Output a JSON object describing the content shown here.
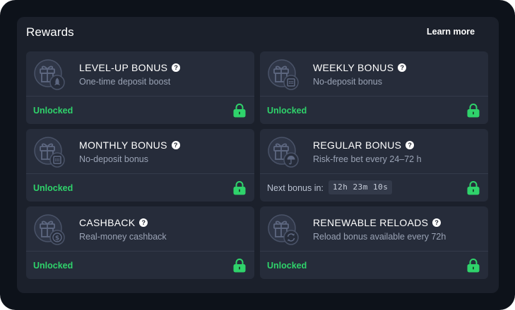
{
  "panel": {
    "title": "Rewards",
    "learn_more": "Learn more"
  },
  "colors": {
    "background": "#0d121a",
    "panel": "#1b202b",
    "card": "#262c3a",
    "unlocked": "#2fd36b",
    "muted_text": "#9aa3b5"
  },
  "cards": [
    {
      "title": "LEVEL-UP BONUS",
      "subtitle": "One-time deposit boost",
      "status": "Unlocked",
      "badge_icon": "rocket-icon"
    },
    {
      "title": "WEEKLY BONUS",
      "subtitle": "No-deposit bonus",
      "status": "Unlocked",
      "badge_icon": "calendar-icon"
    },
    {
      "title": "MONTHLY BONUS",
      "subtitle": "No-deposit bonus",
      "status": "Unlocked",
      "badge_icon": "calendar-icon"
    },
    {
      "title": "REGULAR BONUS",
      "subtitle": "Risk-free bet every 24–72 h",
      "next_label": "Next bonus in:",
      "timer": "12h 23m 10s",
      "badge_icon": "umbrella-icon"
    },
    {
      "title": "CASHBACK",
      "subtitle": "Real-money cashback",
      "status": "Unlocked",
      "badge_icon": "dollar-icon"
    },
    {
      "title": "RENEWABLE RELOADS",
      "subtitle": "Reload bonus available every 72h",
      "status": "Unlocked",
      "badge_icon": "reload-icon"
    }
  ]
}
